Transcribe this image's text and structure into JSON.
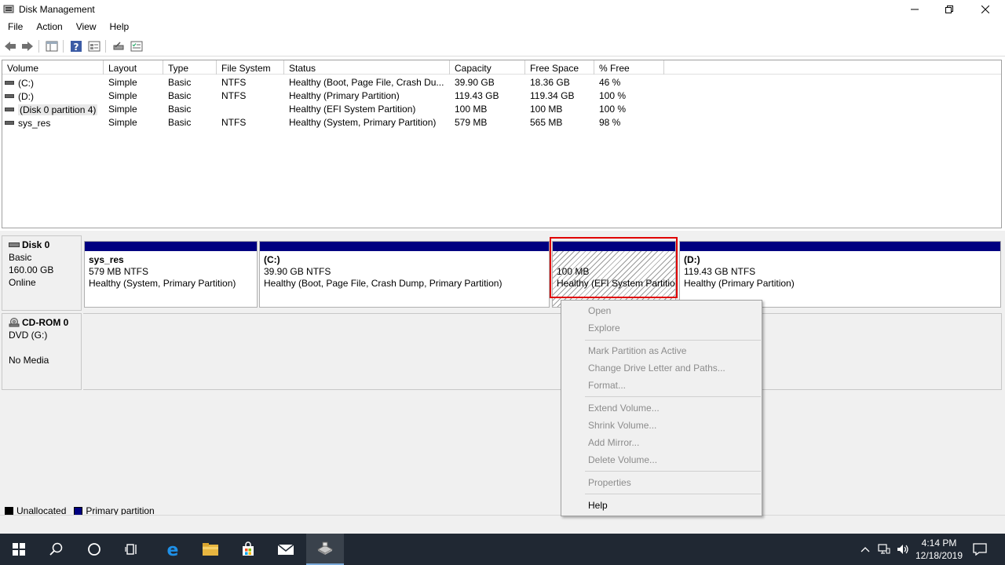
{
  "window": {
    "title": "Disk Management"
  },
  "menu": [
    "File",
    "Action",
    "View",
    "Help"
  ],
  "volume_list": {
    "columns": [
      "Volume",
      "Layout",
      "Type",
      "File System",
      "Status",
      "Capacity",
      "Free Space",
      "% Free"
    ],
    "rows": [
      [
        "(C:)",
        "Simple",
        "Basic",
        "NTFS",
        "Healthy (Boot, Page File, Crash Du...",
        "39.90 GB",
        "18.36 GB",
        "46 %"
      ],
      [
        "(D:)",
        "Simple",
        "Basic",
        "NTFS",
        "Healthy (Primary Partition)",
        "119.43 GB",
        "119.34 GB",
        "100 %"
      ],
      [
        "(Disk 0 partition 4)",
        "Simple",
        "Basic",
        "",
        "Healthy (EFI System Partition)",
        "100 MB",
        "100 MB",
        "100 %"
      ],
      [
        "sys_res",
        "Simple",
        "Basic",
        "NTFS",
        "Healthy (System, Primary Partition)",
        "579 MB",
        "565 MB",
        "98 %"
      ]
    ]
  },
  "disks": [
    {
      "name": "Disk 0",
      "info": [
        "Basic",
        "160.00 GB",
        "Online"
      ],
      "partitions": [
        {
          "name": "sys_res",
          "size": "579 MB NTFS",
          "status": "Healthy (System, Primary Partition)"
        },
        {
          "name": "(C:)",
          "size": "39.90 GB NTFS",
          "status": "Healthy (Boot, Page File, Crash Dump, Primary Partition)"
        },
        {
          "name": "",
          "size": "100 MB",
          "status": "Healthy (EFI System Partitio"
        },
        {
          "name": "(D:)",
          "size": "119.43 GB NTFS",
          "status": "Healthy (Primary Partition)"
        }
      ]
    },
    {
      "name": "CD-ROM 0",
      "info": [
        "DVD (G:)",
        "",
        "No Media"
      ]
    }
  ],
  "legend": [
    {
      "label": "Unallocated",
      "color": "#000000"
    },
    {
      "label": "Primary partition",
      "color": "#000080"
    }
  ],
  "context_menu": {
    "items": [
      {
        "label": "Open",
        "enabled": false
      },
      {
        "label": "Explore",
        "enabled": false
      },
      {
        "label": "Mark Partition as Active",
        "enabled": false
      },
      {
        "label": "Change Drive Letter and Paths...",
        "enabled": false
      },
      {
        "label": "Format...",
        "enabled": false
      },
      {
        "label": "Extend Volume...",
        "enabled": false
      },
      {
        "label": "Shrink Volume...",
        "enabled": false
      },
      {
        "label": "Add Mirror...",
        "enabled": false
      },
      {
        "label": "Delete Volume...",
        "enabled": false
      },
      {
        "label": "Properties",
        "enabled": false
      },
      {
        "label": "Help",
        "enabled": true
      }
    ]
  },
  "taskbar": {
    "time": "4:14 PM",
    "date": "12/18/2019",
    "icons": [
      "windows-start-icon",
      "search-icon",
      "cortana-icon",
      "task-view-icon",
      "edge-icon",
      "file-explorer-icon",
      "store-icon",
      "mail-icon",
      "disk-management-icon"
    ]
  },
  "colors": {
    "primary_partition": "#000080",
    "highlight_box": "#e00000",
    "taskbar": "#202833"
  }
}
